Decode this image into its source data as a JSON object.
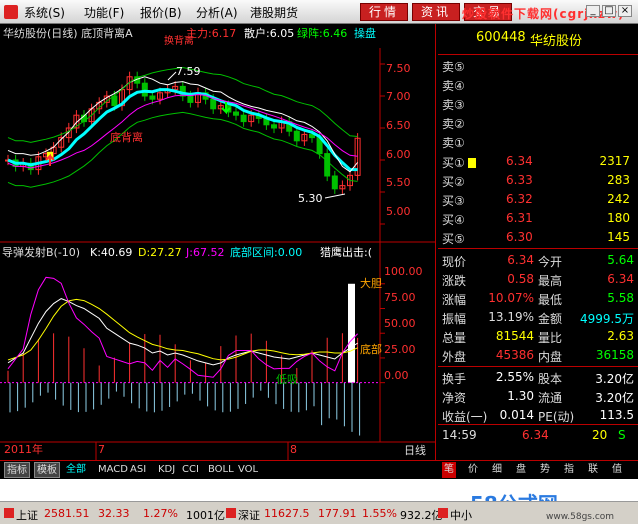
{
  "menu": {
    "items": [
      "系统(S)",
      "功能(F)",
      "报价(B)",
      "分析(A)",
      "港股期货"
    ],
    "buttons": [
      "行情",
      "资讯",
      "交易"
    ],
    "watermark_text": "炒股软件下载网(cgrjxzw)"
  },
  "chart": {
    "title": "华纺股份(日线) 底顶背离A",
    "main_force": "主力:6.17",
    "retail": "散户:6.05",
    "green_line": "绿阵:6.46",
    "switch_label": "操盘",
    "top_clipped": "换背离",
    "price_axis": [
      "7.50",
      "7.00",
      "6.50",
      "6.00",
      "5.50",
      "5.00"
    ],
    "high_label": "7.59",
    "low_label": "5.30",
    "annotation": "底背离",
    "colors": {
      "cyan": "#00ffff",
      "magenta": "#ff00ff",
      "yellow": "#ffff00",
      "white": "#ffffff",
      "green": "#00c000",
      "red": "#ff3030"
    }
  },
  "chart_data": [
    {
      "type": "line",
      "title": "华纺股份(日线) 底顶背离A",
      "ylim": [
        5.0,
        7.75
      ],
      "ticks": [
        5.0,
        5.5,
        6.0,
        6.5,
        7.0,
        7.5
      ],
      "annotations": [
        "7.59",
        "5.30",
        "底背离"
      ],
      "series": [
        {
          "name": "主力",
          "last": 6.17
        },
        {
          "name": "散户",
          "last": 6.05
        },
        {
          "name": "绿阵",
          "last": 6.46
        }
      ]
    },
    {
      "type": "line",
      "title": "导弹发射B(-10)",
      "ylim": [
        -60,
        120
      ],
      "ticks": [
        0,
        25,
        50,
        75,
        100
      ],
      "series": [
        {
          "name": "K",
          "last": 40.69
        },
        {
          "name": "D",
          "last": 27.27
        },
        {
          "name": "J",
          "last": 67.52
        }
      ],
      "annotations": [
        "大胆",
        "底部",
        "低吸"
      ]
    }
  ],
  "indicator": {
    "name": "导弹发射B(-10)",
    "k": "K:40.69",
    "d": "D:27.27",
    "j": "J:67.52",
    "zone": "底部区间:0.00",
    "hawk": "猎鹰出击:(",
    "axis": [
      "100.00",
      "75.00",
      "50.00",
      "25.00",
      "0.00"
    ],
    "label_bold": "大胆",
    "label_bottom": "底部",
    "label_buy": "低吸"
  },
  "date_axis": [
    "2011年",
    "7",
    "8"
  ],
  "period": "日线",
  "quote": {
    "code": "600448",
    "name": "华纺股份",
    "sell": [
      {
        "label": "卖⑤",
        "price": "",
        "vol": ""
      },
      {
        "label": "卖④",
        "price": "",
        "vol": ""
      },
      {
        "label": "卖③",
        "price": "",
        "vol": ""
      },
      {
        "label": "卖②",
        "price": "",
        "vol": ""
      },
      {
        "label": "卖①",
        "price": "",
        "vol": ""
      }
    ],
    "buy": [
      {
        "label": "买①",
        "price": "6.34",
        "vol": "2317"
      },
      {
        "label": "买②",
        "price": "6.33",
        "vol": "283"
      },
      {
        "label": "买③",
        "price": "6.32",
        "vol": "242"
      },
      {
        "label": "买④",
        "price": "6.31",
        "vol": "180"
      },
      {
        "label": "买⑤",
        "price": "6.30",
        "vol": "145"
      }
    ],
    "stats": [
      [
        "现价",
        "6.34",
        "今开",
        "5.64"
      ],
      [
        "涨跌",
        "0.58",
        "最高",
        "6.34"
      ],
      [
        "涨幅",
        "10.07%",
        "最低",
        "5.58"
      ],
      [
        "振幅",
        "13.19%",
        "金额",
        "4999.5万"
      ],
      [
        "总量",
        "81544",
        "量比",
        "2.63"
      ],
      [
        "外盘",
        "45386",
        "内盘",
        "36158"
      ]
    ],
    "stats2": [
      [
        "换手",
        "2.55%",
        "股本",
        "3.20亿"
      ],
      [
        "净资",
        "1.30",
        "流通",
        "3.20亿"
      ],
      [
        "收益(一)",
        "0.014",
        "PE(动)",
        "113.5"
      ]
    ],
    "tick": {
      "time": "14:59",
      "price": "6.34",
      "vol": "20",
      "flag": "S"
    },
    "bottom_tabs": [
      "笔",
      "价",
      "细",
      "盘",
      "势",
      "指",
      "联",
      "值"
    ]
  },
  "tabs": [
    "指标",
    "模板",
    "全部",
    "MACD",
    "ASI",
    "KDJ",
    "CCI",
    "BOLL",
    "VOL"
  ],
  "status": {
    "sh_label": "上证",
    "sh": "2581.51",
    "sh_chg": "32.33",
    "sh_pct": "1.27%",
    "sh_amt": "1001亿",
    "sz_label": "深证",
    "sz": "11627.5",
    "sz_chg": "177.91",
    "sz_pct": "1.55%",
    "sz_amt": "932.2亿",
    "sme_label": "中小"
  },
  "watermark": {
    "main": "58公式网",
    "url": "www.58gs.com"
  }
}
